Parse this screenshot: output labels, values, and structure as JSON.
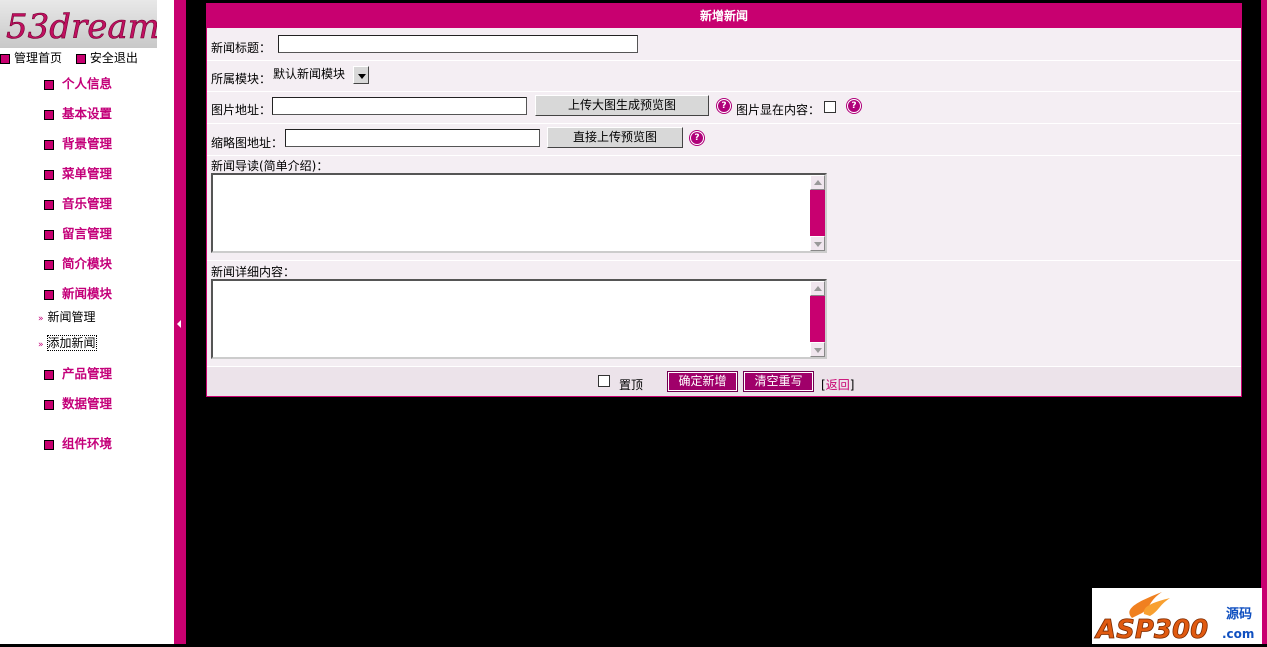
{
  "logo_text": "53dream",
  "top_links": [
    "管理首页",
    "安全退出"
  ],
  "menu": [
    {
      "label": "个人信息"
    },
    {
      "label": "基本设置"
    },
    {
      "label": "背景管理"
    },
    {
      "label": "菜单管理"
    },
    {
      "label": "音乐管理"
    },
    {
      "label": "留言管理"
    },
    {
      "label": "简介模块"
    },
    {
      "label": "新闻模块"
    },
    {
      "label": "产品管理"
    },
    {
      "label": "数据管理"
    },
    {
      "label": "组件环境"
    }
  ],
  "submenu": [
    {
      "label": "新闻管理"
    },
    {
      "label": "添加新闻"
    }
  ],
  "form": {
    "title": "新增新闻",
    "news_title_label": "新闻标题：",
    "news_title_value": "",
    "module_label": "所属模块：",
    "module_selected": "默认新闻模块",
    "image_label": "图片地址：",
    "image_value": "",
    "upload_large_button": "上传大图生成预览图",
    "show_in_content_label": "图片显在内容：",
    "thumb_label": "缩略图地址：",
    "thumb_value": "",
    "upload_thumb_button": "直接上传预览图",
    "intro_label": "新闻导读(简单介绍)：",
    "detail_label": "新闻详细内容：",
    "pin_label": "置顶",
    "submit_button": "确定新增",
    "reset_button": "清空重写",
    "back_open": "[",
    "back_link": "返回",
    "back_close": "]"
  },
  "watermark": {
    "brand": "ASP300",
    "suffix": "源码",
    "domain": ".com"
  },
  "colors": {
    "accent": "#c80070",
    "panel_bg": "#f4eef3",
    "background": "#000000"
  }
}
